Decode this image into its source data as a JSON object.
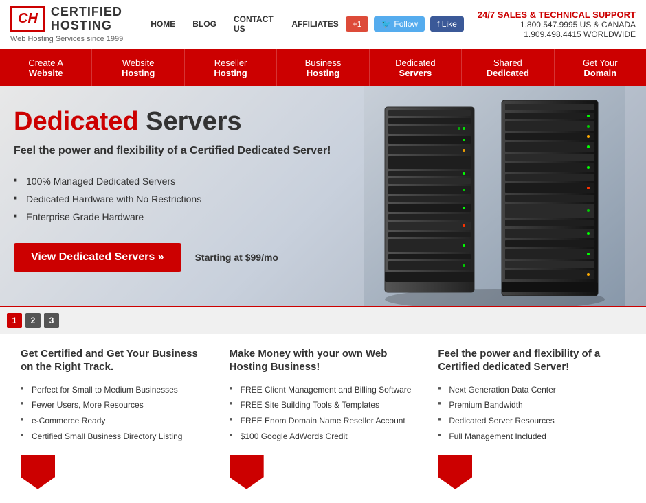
{
  "header": {
    "logo_letters": "CH",
    "logo_line1": "CERTIFIED",
    "logo_line2": "HOSTING",
    "tagline": "Web Hosting Services since 1999",
    "nav": [
      {
        "label": "HOME",
        "href": "#"
      },
      {
        "label": "BLOG",
        "href": "#"
      },
      {
        "label": "CONTACT US",
        "href": "#"
      },
      {
        "label": "AFFILIATES",
        "href": "#"
      }
    ],
    "social": {
      "gplus_label": "+1",
      "twitter_label": "Follow",
      "facebook_label": "Like"
    },
    "support_title": "24/7 SALES & TECHNICAL SUPPORT",
    "phone_us": "1.800.547.9995 US & CANADA",
    "phone_intl": "1.909.498.4415 WORLDWIDE"
  },
  "navbar": {
    "items": [
      {
        "line1": "Create A",
        "line2": "Website"
      },
      {
        "line1": "Website",
        "line2": "Hosting"
      },
      {
        "line1": "Reseller",
        "line2": "Hosting"
      },
      {
        "line1": "Business",
        "line2": "Hosting"
      },
      {
        "line1": "Dedicated",
        "line2": "Servers"
      },
      {
        "line1": "Shared",
        "line2": "Dedicated"
      },
      {
        "line1": "Get Your",
        "line2": "Domain"
      }
    ]
  },
  "hero": {
    "title_red": "Dedicated",
    "title_dark": " Servers",
    "subtitle": "Feel the power and flexibility of a Certified Dedicated Server!",
    "bullets": [
      "100% Managed Dedicated Servers",
      "Dedicated Hardware with No Restrictions",
      "Enterprise Grade Hardware"
    ],
    "cta_button": "View Dedicated Servers »",
    "starting_price": "Starting at $99/mo"
  },
  "slider": {
    "dots": [
      "1",
      "2",
      "3"
    ],
    "active": 0
  },
  "features": [
    {
      "title": "Get Certified and Get Your Business on the Right Track.",
      "bullets": [
        "Perfect for Small to Medium Businesses",
        "Fewer Users, More Resources",
        "e-Commerce Ready",
        "Certified Small Business Directory Listing"
      ]
    },
    {
      "title": "Make Money with your own Web Hosting Business!",
      "bullets": [
        "FREE Client Management and Billing Software",
        "FREE Site Building Tools & Templates",
        "FREE Enom Domain Name Reseller Account",
        "$100 Google AdWords Credit"
      ]
    },
    {
      "title": "Feel the power and flexibility of a Certified dedicated Server!",
      "bullets": [
        "Next Generation Data Center",
        "Premium Bandwidth",
        "Dedicated Server Resources",
        "Full Management Included"
      ]
    }
  ]
}
